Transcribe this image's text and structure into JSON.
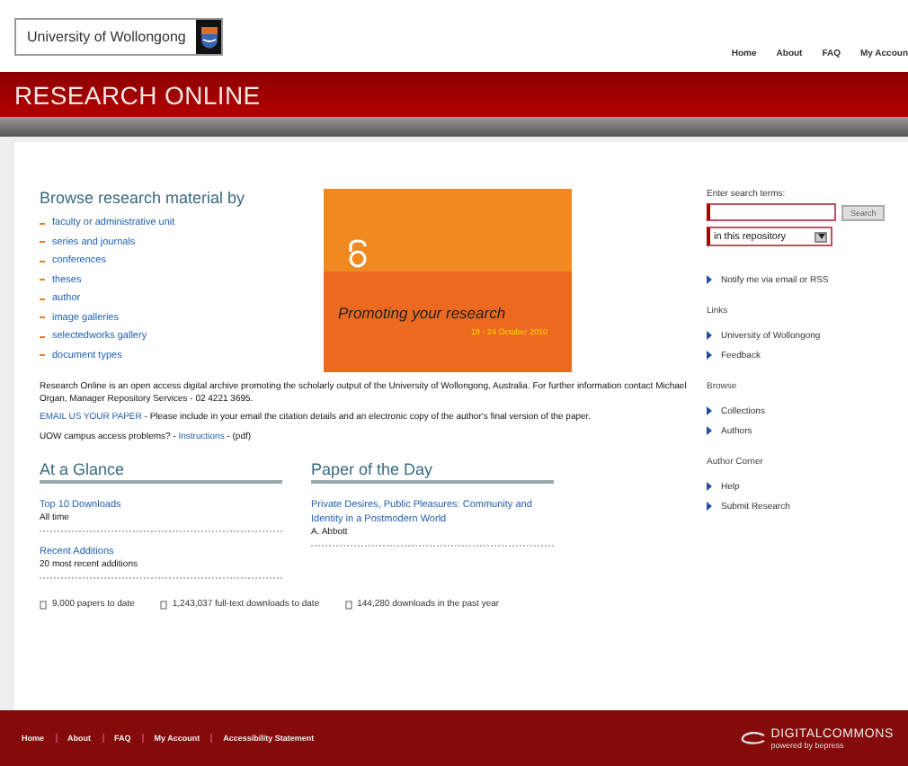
{
  "header": {
    "logo_text": "University of Wollongong",
    "nav": [
      "Home",
      "About",
      "FAQ",
      "My Accoun"
    ]
  },
  "banner": {
    "title": "RESEARCH ONLINE"
  },
  "browse": {
    "heading": "Browse research material by",
    "items": [
      "faculty or administrative unit",
      "series and journals",
      "conferences",
      "theses",
      "author",
      "image galleries",
      "selectedworks gallery",
      "document types"
    ]
  },
  "promo": {
    "headline": "Promoting your research",
    "dates": "18 - 24 October 2010"
  },
  "intro": {
    "text": "Research Online is an open access digital archive promoting the scholarly output of the University of Wollongong, Australia. For further information contact Michael Organ, Manager Repository Services - 02 4221 3695.",
    "email_link": "EMAIL US YOUR PAPER",
    "email_text": " - Please include in your email the citation details and an electronic copy of the author's final version of the paper.",
    "access_text": "UOW campus access problems? - ",
    "access_link": "Instructions",
    "access_suffix": " - (pdf)"
  },
  "at_a_glance": {
    "heading": "At a Glance",
    "entries": [
      {
        "link": "Top 10 Downloads",
        "note": "All time"
      },
      {
        "link": "Recent Additions",
        "note": "20 most recent additions"
      }
    ]
  },
  "paper_of_the_day": {
    "heading": "Paper of the Day",
    "title": "Private Desires, Public Pleasures: Community and Identity in a Postmodern World",
    "author": "A. Abbott"
  },
  "stats": [
    "9,000 papers to date",
    "1,243,037 full-text downloads to date",
    "144,280 downloads in the past year"
  ],
  "sidebar": {
    "search_label": "Enter search terms:",
    "search_button": "Search",
    "scope": "in this repository",
    "notify": "Notify me via email or RSS",
    "sections": [
      {
        "heading": "Links",
        "items": [
          "University of Wollongong",
          "Feedback"
        ]
      },
      {
        "heading": "Browse",
        "items": [
          "Collections",
          "Authors"
        ]
      },
      {
        "heading": "Author Corner",
        "items": [
          "Help",
          "Submit Research"
        ]
      }
    ]
  },
  "footer": {
    "links": [
      "Home",
      "About",
      "FAQ",
      "My Account",
      "Accessibility Statement"
    ],
    "brand": "DIGITALCOMMONS",
    "brand_sub": "powered by bepress"
  }
}
